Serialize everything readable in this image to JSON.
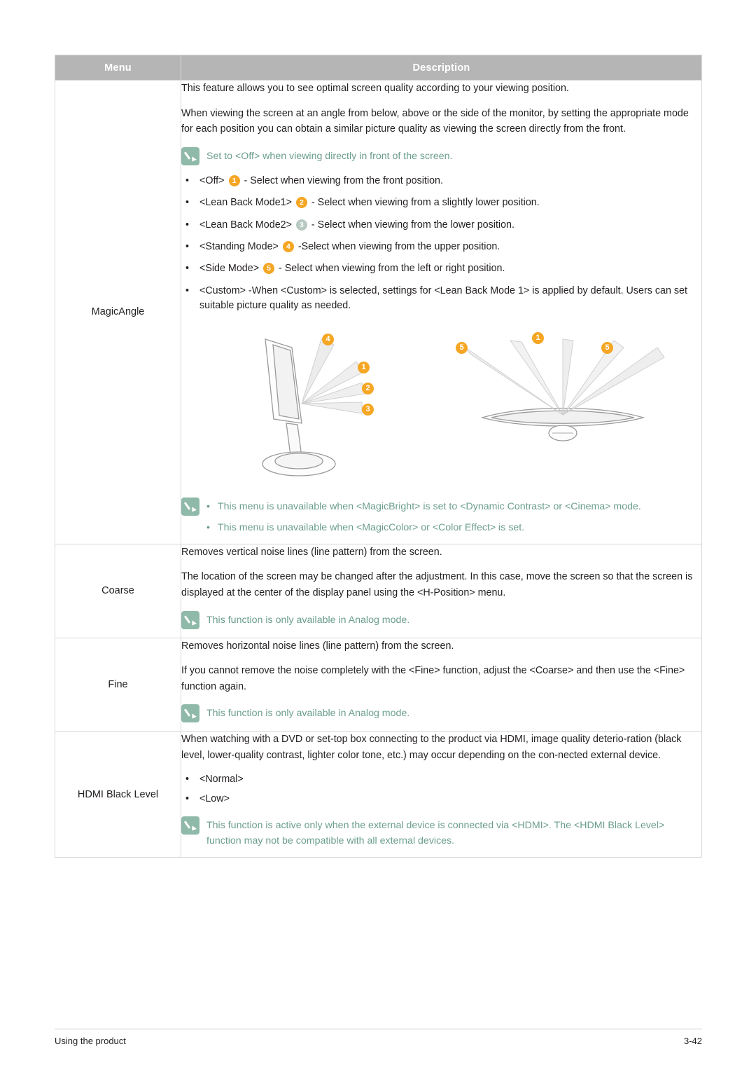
{
  "table": {
    "headers": {
      "menu": "Menu",
      "description": "Description"
    },
    "rows": [
      {
        "menu": "MagicAngle",
        "paragraphs": [
          "This feature allows you to see optimal screen quality according to your viewing position.",
          "When viewing the screen at an angle from below, above or the side of the monitor, by setting the appropriate mode for each position you can obtain a similar picture quality as viewing the screen directly from the front."
        ],
        "note_top": "Set to <Off> when viewing directly in front of the screen.",
        "bullets": [
          {
            "pre": "<Off>",
            "badge": "1",
            "badge_style": "solid",
            "post": "- Select when viewing from the front position."
          },
          {
            "pre": "<Lean Back Mode1>",
            "badge": "2",
            "badge_style": "solid",
            "post": "- Select when viewing from a slightly lower position."
          },
          {
            "pre": "<Lean Back Mode2>",
            "badge": "3",
            "badge_style": "ghost",
            "post": "- Select when viewing from the lower position."
          },
          {
            "pre": "<Standing Mode>",
            "badge": "4",
            "badge_style": "solid",
            "post": "-Select when viewing from the upper position."
          },
          {
            "pre": "<Side Mode>",
            "badge": "5",
            "badge_style": "solid",
            "post": "- Select when viewing from the left or right position."
          },
          {
            "pre": "<Custom> -When <Custom> is selected, settings for <Lean Back Mode 1> is applied by default. Users can set suitable picture quality as needed.",
            "badge": "",
            "badge_style": "none",
            "post": ""
          }
        ],
        "figure": {
          "left_badges": [
            "4",
            "1",
            "2",
            "3"
          ],
          "right_badges": [
            "5",
            "1",
            "5"
          ]
        },
        "note_bottom": [
          "This menu is unavailable when <MagicBright> is set to <Dynamic Contrast> or <Cinema> mode.",
          "This menu is unavailable when <MagicColor> or <Color Effect> is set."
        ]
      },
      {
        "menu": "Coarse",
        "paragraphs": [
          "Removes vertical noise lines (line pattern) from the screen.",
          "The location of the screen may be changed after the adjustment. In this case, move the screen so that the screen is displayed at the center of the display panel using the <H-Position> menu."
        ],
        "note": "This function is only available in Analog mode."
      },
      {
        "menu": "Fine",
        "paragraphs": [
          "Removes horizontal noise lines (line pattern) from the screen.",
          "If you cannot remove the noise completely with the <Fine> function, adjust the <Coarse> and then use the <Fine> function again."
        ],
        "note": "This function is only available in Analog mode."
      },
      {
        "menu": "HDMI Black Level",
        "paragraphs": [
          "When watching with a DVD or set-top box connecting to the product via HDMI, image quality deterio-ration (black level, lower-quality contrast, lighter color tone, etc.) may occur depending on the con-nected external device."
        ],
        "options": [
          "<Normal>",
          "<Low>"
        ],
        "note": "This function is active only when the external device is connected via <HDMI>. The <HDMI Black Level> function may not be compatible with all external devices."
      }
    ]
  },
  "footer": {
    "left": "Using the product",
    "right": "3-42"
  },
  "colors": {
    "header_bg": "#b5b5b5",
    "note_green": "#6b9e8c",
    "badge_orange": "#f5a623",
    "text": "#231f20"
  }
}
